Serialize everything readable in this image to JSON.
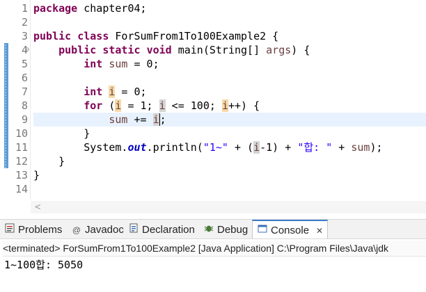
{
  "editor": {
    "line_numbers": [
      "1",
      "2",
      "3",
      "4",
      "5",
      "6",
      "7",
      "8",
      "9",
      "10",
      "11",
      "12",
      "13",
      "14"
    ],
    "fold_marker": "⊖",
    "lines": {
      "l1": {
        "kw": "package",
        "rest": " chapter04;"
      },
      "l3": {
        "kw1": "public",
        "kw2": "class",
        "rest": " ForSumFrom1To100Example2 {"
      },
      "l4": {
        "kw1": "public",
        "kw2": "static",
        "kw3": "void",
        "rest": " main(String[] ",
        "param": "args",
        ")": ") {"
      },
      "l5": {
        "kw": "int",
        "sp": " ",
        "var": "sum",
        "rest": " = 0;"
      },
      "l7": {
        "kw": "int",
        "sp": " ",
        "var": "i",
        "rest": " = 0;"
      },
      "l8": {
        "kw": "for",
        "p1": " (",
        "v1": "i",
        "p2": " = 1; ",
        "v2": "i",
        "p3": " <= 100; ",
        "v3": "i",
        "p4": "++) {"
      },
      "l9": {
        "var": "sum",
        "mid": " += ",
        "v2": "i",
        "end": ";"
      },
      "l10": {
        "text": "}"
      },
      "l11": {
        "a": "System.",
        "fld": "out",
        "b": ".println(",
        "s1": "\"1~\"",
        "c": " + (",
        "v": "i",
        "d": "-1) + ",
        "s2": "\"합: \"",
        "e": " + ",
        "v2": "sum",
        "f": ");"
      },
      "l12": {
        "text": "}"
      },
      "l13": {
        "text": "}"
      }
    }
  },
  "scrollbar": {
    "left_arrow": "<"
  },
  "tabs": {
    "problems": "Problems",
    "javadoc": "Javadoc",
    "declaration": "Declaration",
    "debug": "Debug",
    "console": "Console",
    "close": "✕"
  },
  "console": {
    "terminated": "<terminated> ForSumFrom1To100Example2 [Java Application] C:\\Program Files\\Java\\jdk",
    "output": "1~100합: 5050"
  }
}
